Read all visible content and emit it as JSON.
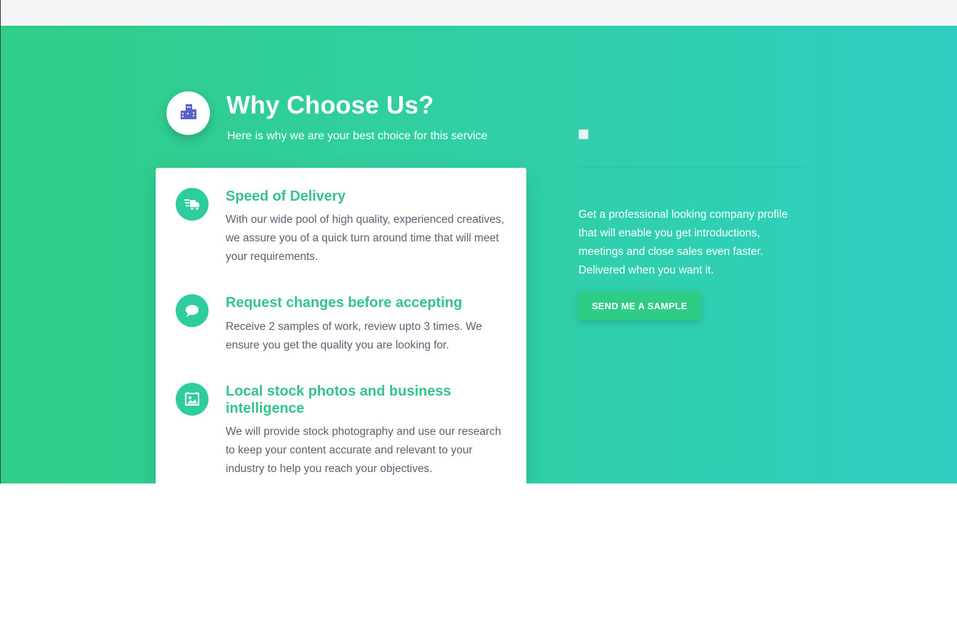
{
  "header": {
    "title": "Why Choose Us?",
    "subtitle": "Here is why we are your best choice for this service",
    "icon": "building-icon"
  },
  "features": [
    {
      "icon": "delivery-truck-icon",
      "title": "Speed of Delivery",
      "text": "With our wide pool of high quality, experienced creatives, we assure you of a quick turn around time that will meet your requirements."
    },
    {
      "icon": "chat-bubble-icon",
      "title": "Request changes before accepting",
      "text": "Receive 2 samples of work, review upto 3 times. We ensure you get the quality you are looking for."
    },
    {
      "icon": "photo-icon",
      "title": "Local stock photos and business intelligence",
      "text": "We will provide stock photography and use our research to keep your content accurate and relevant to your industry to help you reach your objectives."
    }
  ],
  "promo": {
    "text": "Get a professional looking company profile that will enable you get introductions, meetings and close sales even faster. Delivered when you want it.",
    "button_label": "SEND ME A SAMPLE"
  },
  "colors": {
    "gradient_start": "#2fcd86",
    "gradient_end": "#2ecfc2",
    "accent_green": "#34c48a",
    "icon_bg": "#2fcca0",
    "badge_icon": "#5a63c9"
  }
}
